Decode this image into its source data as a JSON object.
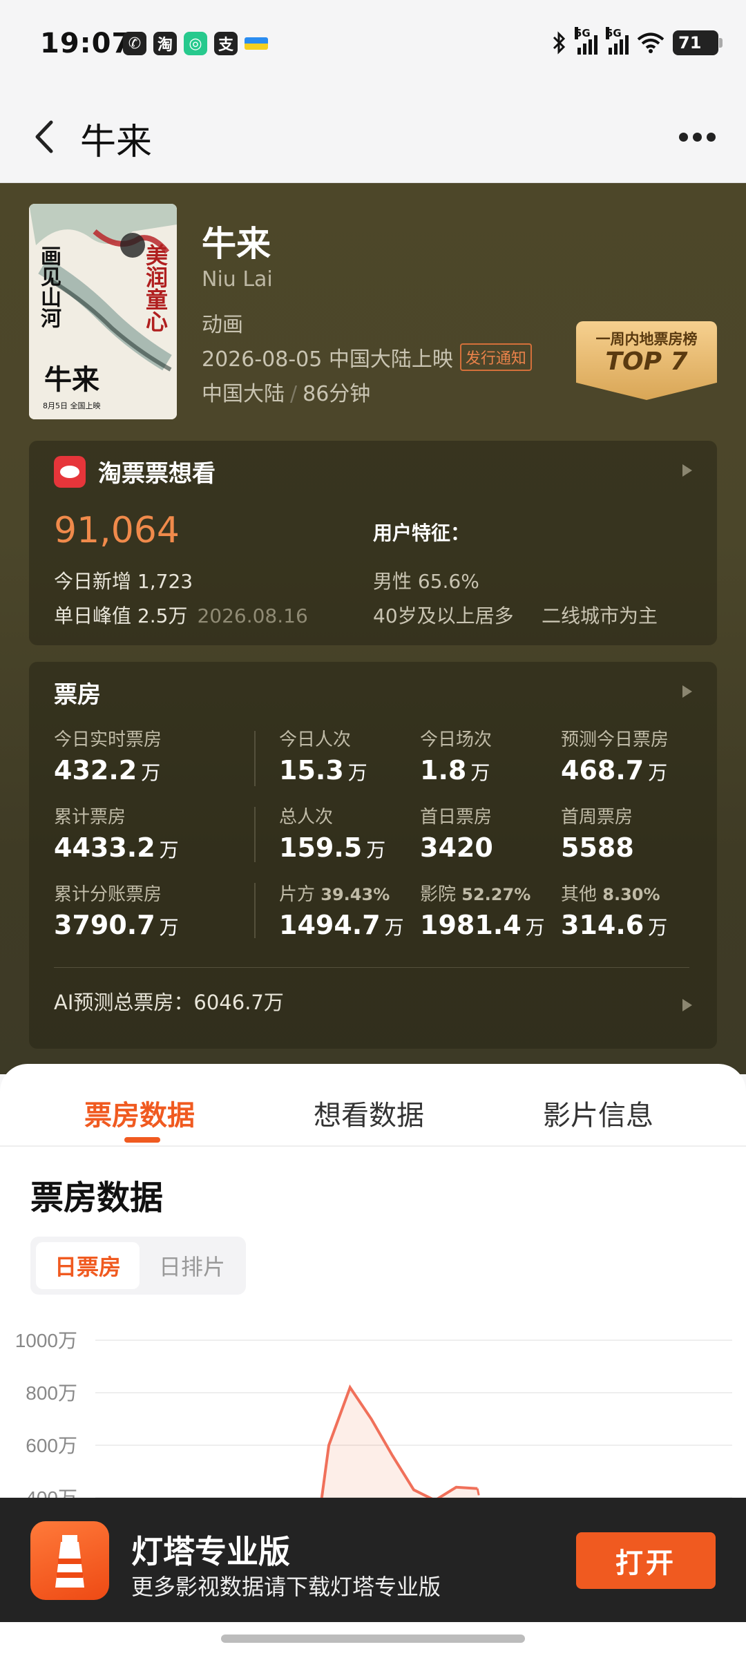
{
  "status": {
    "time": "19:07",
    "battery": "71",
    "network": [
      "5G",
      "5G"
    ]
  },
  "nav": {
    "title": "牛来"
  },
  "poster": {
    "title": "牛来",
    "vertical_left": "画见山河",
    "vertical_right": "美润童心",
    "date": "8月5日 全国上映"
  },
  "movie": {
    "title": "牛来",
    "english_title": "Niu Lai",
    "genre": "动画",
    "release": "2026-08-05 中国大陆上映",
    "release_tag": "发行通知",
    "region": "中国大陆",
    "duration": "86分钟"
  },
  "rank": {
    "label": "一周内地票房榜",
    "value": "TOP 7"
  },
  "want": {
    "title": "淘票票想看",
    "total": "91,064",
    "today_label": "今日新增",
    "today_value": "1,723",
    "peak_label": "单日峰值",
    "peak_value": "2.5万",
    "peak_date": "2026.08.16",
    "user_title": "用户特征：",
    "gender": "男性 65.6%",
    "age": "40岁及以上居多",
    "city": "二线城市为主"
  },
  "box": {
    "title": "票房",
    "realtime_label": "今日实时票房",
    "realtime_value": "432.2",
    "realtime_unit": "万",
    "today_viewers_label": "今日人次",
    "today_viewers_value": "15.3",
    "today_viewers_unit": "万",
    "today_shows_label": "今日场次",
    "today_shows_value": "1.8",
    "today_shows_unit": "万",
    "forecast_label": "预测今日票房",
    "forecast_value": "468.7",
    "forecast_unit": "万",
    "cumulative_label": "累计票房",
    "cumulative_value": "4433.2",
    "cumulative_unit": "万",
    "total_viewers_label": "总人次",
    "total_viewers_value": "159.5",
    "total_viewers_unit": "万",
    "first_day_label": "首日票房",
    "first_day_value": "3420",
    "first_week_label": "首周票房",
    "first_week_value": "5588",
    "split_label": "累计分账票房",
    "split_value": "3790.7",
    "split_unit": "万",
    "producer_label": "片方",
    "producer_pct": "39.43%",
    "producer_value": "1494.7",
    "producer_unit": "万",
    "cinema_label": "影院",
    "cinema_pct": "52.27%",
    "cinema_value": "1981.4",
    "cinema_unit": "万",
    "other_label": "其他",
    "other_pct": "8.30%",
    "other_value": "314.6",
    "other_unit": "万",
    "ai_text": "AI预测总票房：6046.7万"
  },
  "tabs": [
    "票房数据",
    "想看数据",
    "影片信息"
  ],
  "section": {
    "title": "票房数据",
    "seg_on": "日票房",
    "seg_off": "日排片"
  },
  "colors": {
    "accent": "#f05a20",
    "hero_bg": "#4b462a"
  },
  "chart_data": {
    "type": "area",
    "y_ticks": [
      "1000万",
      "800万",
      "600万",
      "400万"
    ],
    "ylim": [
      0,
      1000
    ],
    "values": [
      0,
      0,
      0,
      0,
      0,
      0,
      0,
      0,
      0,
      0,
      0,
      600,
      820,
      700,
      560,
      430,
      390,
      440,
      435,
      40,
      20,
      20,
      20,
      20,
      20,
      20,
      20,
      20,
      20,
      20,
      20
    ],
    "forecast_start_index": 18
  },
  "promo": {
    "title": "灯塔专业版",
    "subtitle": "更多影视数据请下载灯塔专业版",
    "button": "打开"
  }
}
